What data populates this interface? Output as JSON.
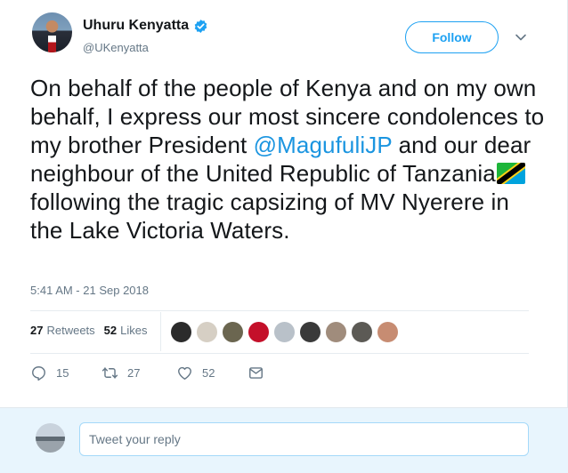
{
  "user": {
    "display_name": "Uhuru Kenyatta",
    "handle": "@UKenyatta",
    "verified_icon": "verified-badge-icon"
  },
  "follow_button": {
    "label": "Follow"
  },
  "tweet": {
    "text_part1": "On behalf of the people of Kenya and on my own behalf, I express our most sincere condolences to my brother President ",
    "mention": "@MagufuliJP",
    "text_part2": " and our dear neighbour of the United Republic of Tanzania",
    "flag_icon": "tanzania-flag-icon",
    "text_part3": " following the tragic capsizing of MV Nyerere in the Lake Victoria Waters.",
    "timestamp": "5:41 AM - 21 Sep 2018"
  },
  "stats": {
    "retweets_count": "27",
    "retweets_label": "Retweets",
    "likes_count": "52",
    "likes_label": "Likes"
  },
  "likers": [
    {
      "color": "#2b2b2b"
    },
    {
      "color": "#d6cfc4"
    },
    {
      "color": "#6b6650"
    },
    {
      "color": "#c4102a"
    },
    {
      "color": "#b9c1c9"
    },
    {
      "color": "#3a3a3a"
    },
    {
      "color": "#a08c7c"
    },
    {
      "color": "#5c5a55"
    },
    {
      "color": "#c78c72"
    }
  ],
  "actions": {
    "reply_count": "15",
    "retweet_count": "27",
    "like_count": "52"
  },
  "reply": {
    "placeholder": "Tweet your reply"
  },
  "colors": {
    "accent": "#1da1f2",
    "mention": "#1b95e0",
    "muted": "#657786",
    "reply_bg": "#e8f5fd"
  }
}
